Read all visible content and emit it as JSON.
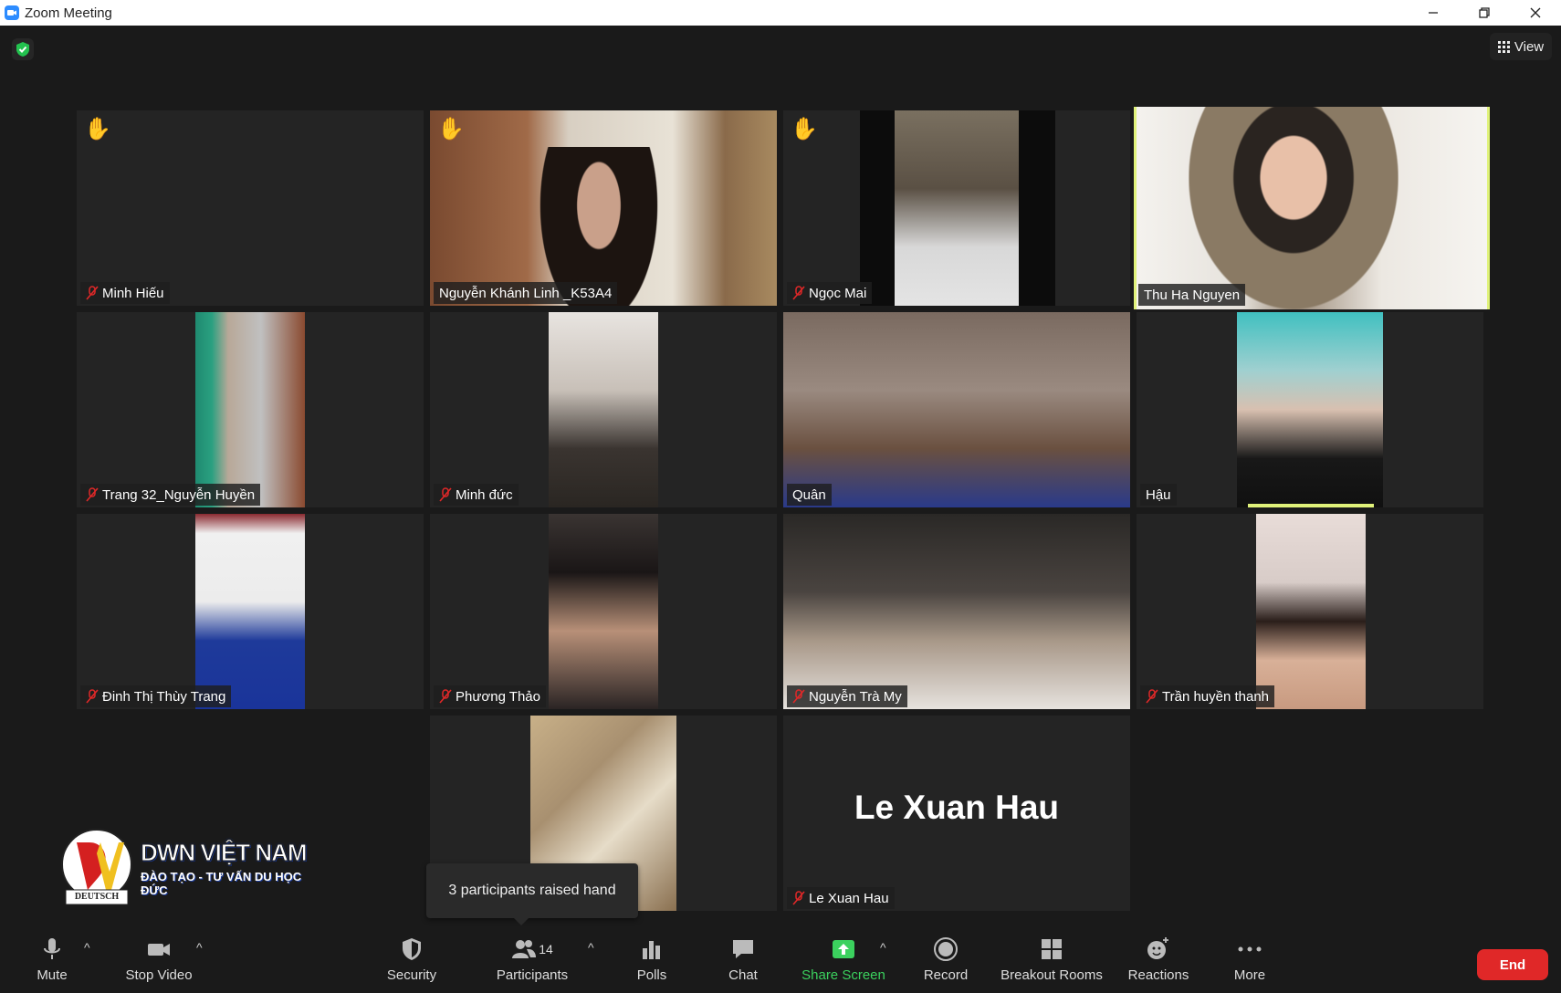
{
  "window": {
    "title": "Zoom Meeting"
  },
  "header": {
    "view_label": "View"
  },
  "tiles": [
    {
      "name": "Minh Hiếu",
      "hand": "✋"
    },
    {
      "name": "Nguyễn Khánh Linh _K53A4",
      "hand": "✋"
    },
    {
      "name": "Ngọc Mai",
      "hand": "✋"
    },
    {
      "name": "Thu Ha Nguyen"
    },
    {
      "name": "Trang 32_Nguyễn Huyền"
    },
    {
      "name": "Minh đức"
    },
    {
      "name": "Quân"
    },
    {
      "name": "Hậu"
    },
    {
      "name": "Đinh Thị Thùy Trang"
    },
    {
      "name": "Phương Thảo"
    },
    {
      "name": "Nguyễn Trà My"
    },
    {
      "name": "Trần huyền thanh"
    },
    {
      "name": "Le Xuan Hau",
      "display": "Le Xuan Hau"
    }
  ],
  "tooltip": "3 participants raised hand",
  "logo": {
    "brand": "DWN VIỆT NAM",
    "tagline": "ĐÀO TẠO - TƯ VẤN DU HỌC ĐỨC",
    "seal": "DEUTSCH"
  },
  "toolbar": {
    "mute": "Mute",
    "video": "Stop Video",
    "security": "Security",
    "participants": "Participants",
    "participants_count": "14",
    "polls": "Polls",
    "chat": "Chat",
    "share": "Share Screen",
    "record": "Record",
    "breakout": "Breakout Rooms",
    "reactions": "Reactions",
    "more": "More",
    "end": "End"
  },
  "colors": {
    "accent_green": "#3bd15e",
    "end_red": "#e02828",
    "active_border": "#e0f27a"
  }
}
